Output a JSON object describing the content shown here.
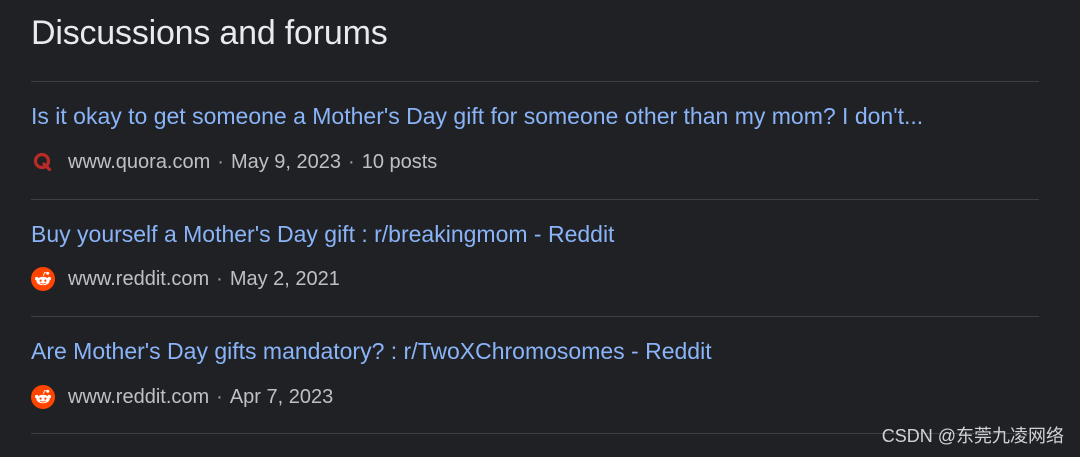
{
  "section": {
    "title": "Discussions and forums"
  },
  "results": [
    {
      "title": "Is it okay to get someone a Mother's Day gift for someone other than my mom? I don't...",
      "site_icon": "quora-icon",
      "domain": "www.quora.com",
      "date": "May 9, 2023",
      "posts": "10 posts"
    },
    {
      "title": "Buy yourself a Mother's Day gift : r/breakingmom - Reddit",
      "site_icon": "reddit-icon",
      "domain": "www.reddit.com",
      "date": "May 2, 2021"
    },
    {
      "title": "Are Mother's Day gifts mandatory? : r/TwoXChromosomes - Reddit",
      "site_icon": "reddit-icon",
      "domain": "www.reddit.com",
      "date": "Apr 7, 2023"
    }
  ],
  "watermark": "CSDN @东莞九凌网络",
  "colors": {
    "background": "#202124",
    "link": "#8ab4f8",
    "text_primary": "#e8eaed",
    "text_secondary": "#bdc1c6",
    "divider": "#3c4043",
    "quora_red": "#b92b27",
    "reddit_orange": "#ff4500"
  }
}
